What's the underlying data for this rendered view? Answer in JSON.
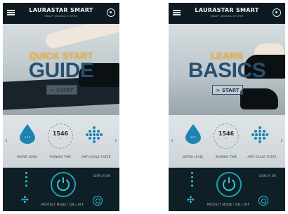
{
  "screens": [
    {
      "brand": "LAURASTAR SMART",
      "brand_sub": "SMART IRONING SYSTEM",
      "hero_kicker": "QUICK START",
      "hero_title": "GUIDE",
      "start_label": "> START",
      "stats": {
        "water_label": "WATER LEVEL",
        "water_value": "•••",
        "counter_value": "1546",
        "counter_sub": "h",
        "counter_label": "IRONING TIME",
        "filter_label": "ANTI-SCALE FILTER"
      },
      "controls": {
        "power_label": "PROTECT MODE / ON / OFF",
        "display_label": "DISPLAY ON"
      }
    },
    {
      "brand": "LAURASTAR SMART",
      "brand_sub": "SMART IRONING SYSTEM",
      "hero_kicker": "LEARN",
      "hero_title": "BASICS",
      "start_label": "> START",
      "stats": {
        "water_label": "WATER LEVEL",
        "water_value": "•••",
        "counter_value": "1546",
        "counter_sub": "h",
        "counter_label": "IRONING TIME",
        "filter_label": "ANTI-SCALE FILTER"
      },
      "controls": {
        "power_label": "PROTECT MODE / ON / OFF",
        "display_label": "DISPLAY ON"
      }
    }
  ],
  "colors": {
    "accent_orange": "#f7b32b",
    "title_blue": "#26516e",
    "teal": "#2ec4d8",
    "water_blue": "#1e83ae"
  },
  "icons": [
    "menu-icon",
    "settings-icon",
    "water-drop-icon",
    "filter-icon",
    "power-icon",
    "fan-icon",
    "target-icon",
    "chevron-left-icon",
    "chevron-right-icon"
  ]
}
